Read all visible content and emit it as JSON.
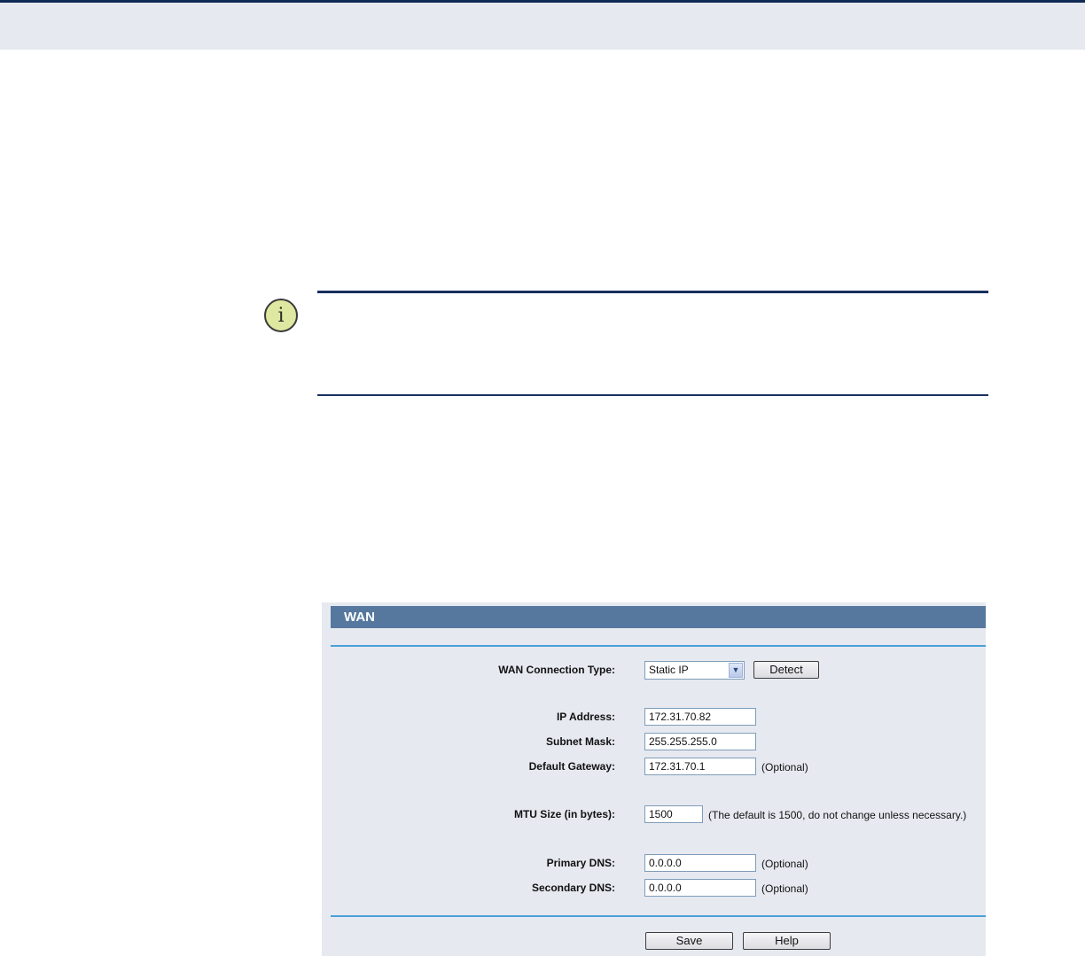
{
  "note": {
    "icon": "info-icon",
    "icon_glyph": "i",
    "rule_color": "#18305f"
  },
  "wan": {
    "title": "WAN",
    "connection_type_label": "WAN Connection Type:",
    "connection_type_value": "Static IP",
    "detect_label": "Detect",
    "ip_label": "IP Address:",
    "ip_value": "172.31.70.82",
    "subnet_label": "Subnet Mask:",
    "subnet_value": "255.255.255.0",
    "gateway_label": "Default Gateway:",
    "gateway_value": "172.31.70.1",
    "gateway_hint": "(Optional)",
    "mtu_label": "MTU Size (in bytes):",
    "mtu_value": "1500",
    "mtu_hint": "(The default is 1500, do not change unless necessary.)",
    "primary_dns_label": "Primary DNS:",
    "primary_dns_value": "0.0.0.0",
    "primary_dns_hint": "(Optional)",
    "secondary_dns_label": "Secondary DNS:",
    "secondary_dns_value": "0.0.0.0",
    "secondary_dns_hint": "(Optional)",
    "save_label": "Save",
    "help_label": "Help",
    "title_bar_color": "#56789e",
    "panel_color": "#e6e9f0",
    "rule_color": "#4aa0d8"
  }
}
